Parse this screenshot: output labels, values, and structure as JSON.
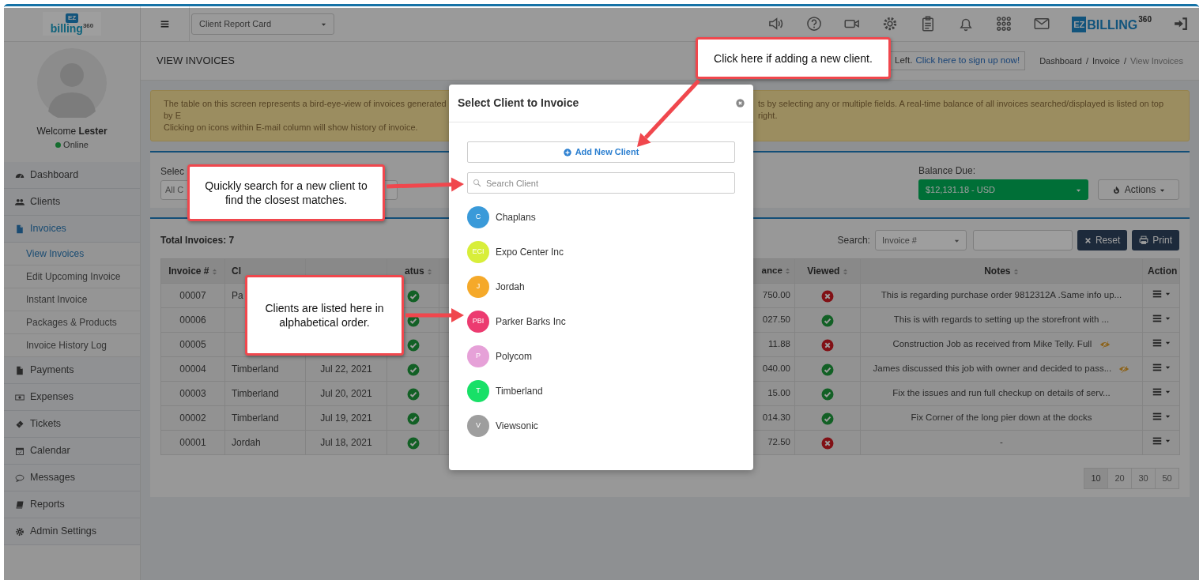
{
  "sidebar": {
    "logo": {
      "badge": "EZ",
      "word": "billing",
      "superscript": "360"
    },
    "user": {
      "greeting": "Welcome",
      "name": "Lester",
      "status": "Online",
      "online": true
    },
    "items": [
      {
        "label": "Dashboard",
        "selected": false
      },
      {
        "label": "Clients",
        "selected": false
      },
      {
        "label": "Invoices",
        "selected": true,
        "children": [
          {
            "label": "View Invoices",
            "selected": true
          },
          {
            "label": "Edit Upcoming Invoice",
            "selected": false
          },
          {
            "label": "Instant Invoice",
            "selected": false
          },
          {
            "label": "Packages & Products",
            "selected": false
          },
          {
            "label": "Invoice History Log",
            "selected": false
          }
        ]
      },
      {
        "label": "Payments",
        "selected": false
      },
      {
        "label": "Expenses",
        "selected": false
      },
      {
        "label": "Tickets",
        "selected": false
      },
      {
        "label": "Calendar",
        "selected": false
      },
      {
        "label": "Messages",
        "selected": false
      },
      {
        "label": "Reports",
        "selected": false
      },
      {
        "label": "Admin Settings",
        "selected": false
      }
    ]
  },
  "topbar": {
    "report_select": "Client Report Card",
    "brand": {
      "badge": "EZ",
      "name": "BILLING",
      "superscript": "360"
    }
  },
  "page_header": {
    "title": "VIEW INVOICES",
    "signup": {
      "text": "Left.",
      "link": "Click here to sign up now!"
    },
    "breadcrumb": [
      {
        "label": "Dashboard",
        "separator": "/",
        "current": false
      },
      {
        "label": "Invoice",
        "separator": "/",
        "current": false
      },
      {
        "label": "View Invoices",
        "current": true
      }
    ]
  },
  "banner": {
    "text_start": "The table on this screen represents a bird-eye-view of invoices generated by E",
    "text_end": "ts by selecting any or multiple fields. A real-time balance of all invoices searched/displayed is listed on top right.",
    "line_2": "Clicking on icons within E-mail column will show history of invoice."
  },
  "filter": {
    "label": "Selec",
    "select_value": "All C",
    "balance_label": "Balance Due:",
    "balance_value": "$12,131.18 - USD",
    "actions_button": "Actions"
  },
  "invoices": {
    "total": "Total Invoices: 7",
    "search_label": "Search:",
    "search_field": "Invoice #",
    "reset_button": "Reset",
    "print_button": "Print",
    "columns": [
      {
        "label": "Invoice #",
        "sortable": true
      },
      {
        "label": "Cl",
        "sortable": false
      },
      {
        "label": "atus",
        "sortable": true
      },
      {
        "label": "ance",
        "sortable": true
      },
      {
        "label": "Viewed",
        "sortable": true
      },
      {
        "label": "Notes",
        "sortable": true
      },
      {
        "label": "Action",
        "sortable": false
      }
    ],
    "rows": [
      {
        "invoice": "00007",
        "client": "Pa",
        "status_ok": true,
        "balance": "750.00",
        "viewed": false,
        "notes": "This is regarding purchase order 9812312A .Same info up...",
        "note_icon": false
      },
      {
        "invoice": "00006",
        "status_ok": true,
        "balance": "027.50",
        "viewed": true,
        "notes": "This is with regards to setting up the storefront with ...",
        "note_icon": false
      },
      {
        "invoice": "00005",
        "status_ok": true,
        "balance": "11.88",
        "viewed": false,
        "notes": "Construction Job as received from Mike Telly. Full",
        "note_icon": true
      },
      {
        "invoice": "00004",
        "client": "Timberland",
        "date": "Jul 22, 2021",
        "status_ok": true,
        "balance": "040.00",
        "viewed": true,
        "notes": "James discussed this job with owner and decided to pass...",
        "note_icon": true
      },
      {
        "invoice": "00003",
        "client": "Timberland",
        "date": "Jul 20, 2021",
        "status_ok": true,
        "balance": "15.00",
        "viewed": true,
        "notes": "Fix the issues and run full checkup on details of serv...",
        "note_icon": false
      },
      {
        "invoice": "00002",
        "client": "Timberland",
        "date": "Jul 19, 2021",
        "status_ok": true,
        "balance": "014.30",
        "viewed": true,
        "notes": "Fix Corner of the long pier down at the docks",
        "note_icon": false
      },
      {
        "invoice": "00001",
        "client": "Jordah",
        "date": "Jul 18, 2021",
        "status_ok": true,
        "balance": "72.50",
        "viewed": false,
        "notes": "-",
        "note_icon": false
      }
    ],
    "page_sizes": [
      {
        "label": "10",
        "selected": true
      },
      {
        "label": "20",
        "selected": false
      },
      {
        "label": "30",
        "selected": false
      },
      {
        "label": "50",
        "selected": false
      }
    ]
  },
  "modal": {
    "title": "Select Client to Invoice",
    "add_button": "Add New Client",
    "search_placeholder": "Search Client",
    "clients": [
      {
        "initials": "C",
        "name": "Chaplans",
        "color": "#3a9ad9"
      },
      {
        "initials": "ECI",
        "name": "Expo Center Inc",
        "color": "#d8ee3a"
      },
      {
        "initials": "J",
        "name": "Jordah",
        "color": "#f5a92a"
      },
      {
        "initials": "PBI",
        "name": "Parker Barks Inc",
        "color": "#ec3b70"
      },
      {
        "initials": "P",
        "name": "Polycom",
        "color": "#e6a1d8"
      },
      {
        "initials": "T",
        "name": "Timberland",
        "color": "#18e067"
      },
      {
        "initials": "V",
        "name": "Viewsonic",
        "color": "#9e9e9e"
      }
    ]
  },
  "callouts": [
    {
      "text": "Click here if adding a new client."
    },
    {
      "text": "Quickly search for a new client to find the closest matches."
    },
    {
      "text": "Clients are listed here in alphabetical order."
    }
  ]
}
